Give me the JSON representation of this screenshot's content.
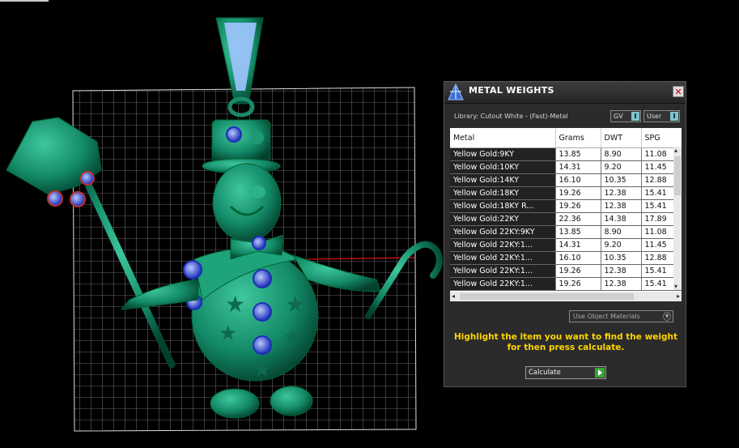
{
  "panel": {
    "title": "METAL WEIGHTS",
    "close_label": "✕",
    "library": "Library: Cutout White - (Fast)-Metal",
    "toggle_gv": "GV",
    "toggle_user": "User",
    "toggle_knob": "I"
  },
  "table": {
    "headers": [
      "Metal",
      "Grams",
      "DWT",
      "SPG"
    ],
    "rows": [
      [
        "Yellow Gold:9KY",
        "13.85",
        "8.90",
        "11.08"
      ],
      [
        "Yellow Gold:10KY",
        "14.31",
        "9.20",
        "11.45"
      ],
      [
        "Yellow Gold:14KY",
        "16.10",
        "10.35",
        "12.88"
      ],
      [
        "Yellow Gold:18KY",
        "19.26",
        "12.38",
        "15.41"
      ],
      [
        "Yellow Gold:18KY R...",
        "19.26",
        "12.38",
        "15.41"
      ],
      [
        "Yellow Gold:22KY",
        "22.36",
        "14.38",
        "17.89"
      ],
      [
        "Yellow Gold 22KY:9KY",
        "13.85",
        "8.90",
        "11.08"
      ],
      [
        "Yellow Gold 22KY:1...",
        "14.31",
        "9.20",
        "11.45"
      ],
      [
        "Yellow Gold 22KY:1...",
        "16.10",
        "10.35",
        "12.88"
      ],
      [
        "Yellow Gold 22KY:1...",
        "19.26",
        "12.38",
        "15.41"
      ],
      [
        "Yellow Gold 22KY:1...",
        "19.26",
        "12.38",
        "15.41"
      ]
    ]
  },
  "materials_dropdown": "Use Object Materials",
  "hint_text": "Highlight the item you want to find the weight for then press calculate.",
  "calculate_label": "Calculate",
  "colors": {
    "model": "#1a8a6a",
    "gem_blue": "#4a6fe0",
    "hint_yellow": "#ffd400",
    "grid": "#cfcfcf"
  },
  "icons": [
    "scale-icon",
    "close-icon",
    "chevron-down-icon",
    "play-icon"
  ]
}
